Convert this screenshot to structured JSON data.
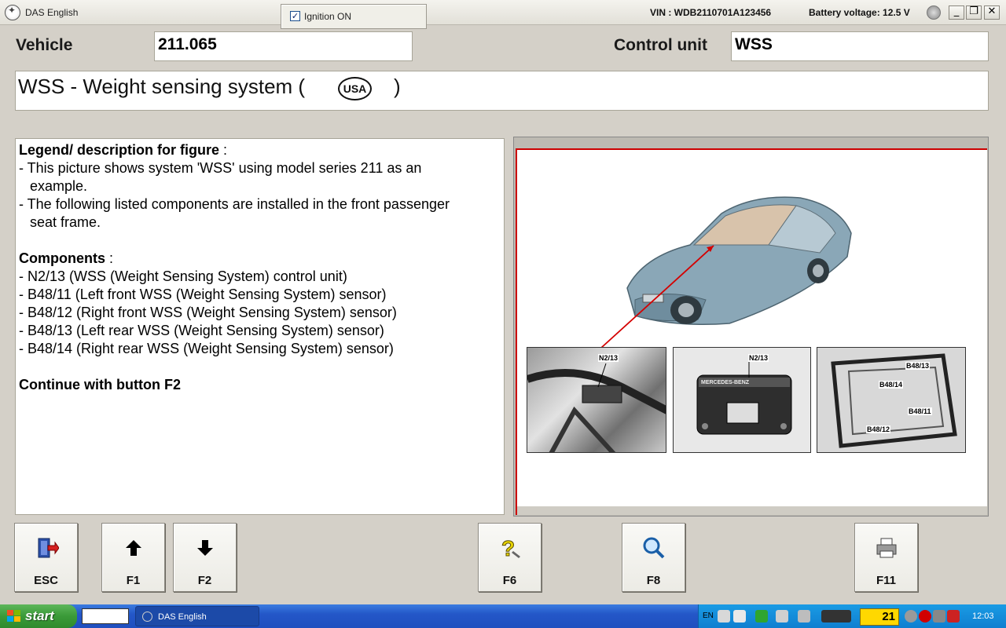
{
  "window": {
    "title": "DAS English",
    "ignition_label": "Ignition ON",
    "ignition_checked": true,
    "vin": "VIN : WDB2110701A123456",
    "battery": "Battery voltage: 12.5 V",
    "controls": {
      "minimize": "_",
      "restore": "❐",
      "close": "✕"
    }
  },
  "header": {
    "vehicle_label": "Vehicle",
    "vehicle_value": "211.065",
    "control_unit_label": "Control unit",
    "control_unit_value": "WSS"
  },
  "title_bar": {
    "text": "WSS - Weight sensing system (",
    "badge": "USA",
    "close": ")"
  },
  "description": {
    "legend_heading": "Legend/ description for figure",
    "legend_suffix": " :",
    "line1a": "- This picture shows system 'WSS' using model series 211 as an",
    "line1b": "example.",
    "line2a": "- The following listed components are installed in the front passenger",
    "line2b": "seat frame.",
    "components_heading": "Components",
    "components_suffix": " :",
    "components": [
      "- N2/13 (WSS (Weight Sensing System) control unit)",
      "- B48/11 (Left front WSS (Weight Sensing System) sensor)",
      "- B48/12 (Right front WSS (Weight Sensing System) sensor)",
      "- B48/13 (Left rear WSS (Weight Sensing System) sensor)",
      "- B48/14 (Right rear WSS (Weight Sensing System) sensor)"
    ],
    "continue": "Continue with button F2"
  },
  "figure": {
    "photo1_label": "N2/13",
    "photo2_label": "N2/13",
    "photo2_brand": "MERCEDES-BENZ",
    "photo3_labels": [
      "B48/13",
      "B48/14",
      "B48/11",
      "B48/12"
    ]
  },
  "buttons": {
    "esc": "ESC",
    "f1": "F1",
    "f2": "F2",
    "f6": "F6",
    "f8": "F8",
    "f11": "F11"
  },
  "taskbar": {
    "start": "start",
    "task": "DAS English",
    "lang": "EN",
    "badge": "21",
    "time": "12:03"
  }
}
